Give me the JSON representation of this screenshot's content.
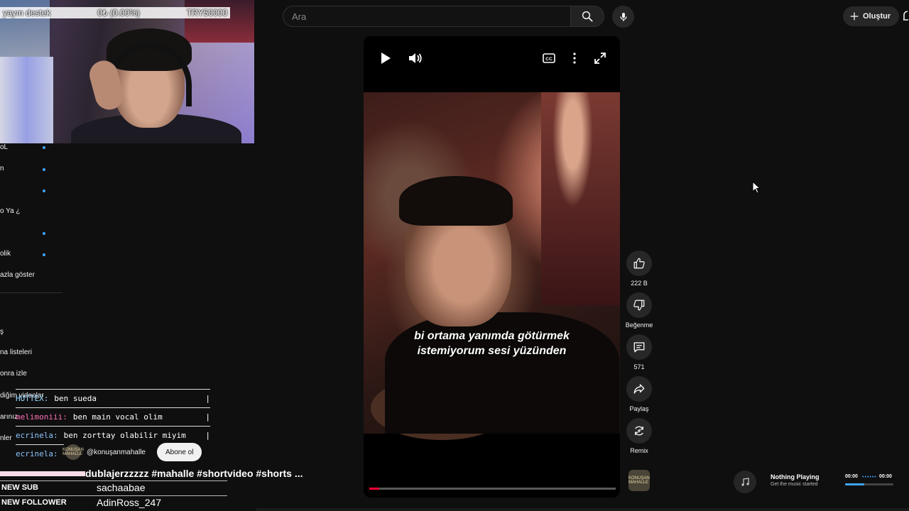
{
  "search": {
    "placeholder": "Ara"
  },
  "header": {
    "create_label": "Oluştur"
  },
  "stream_overlay": {
    "donation": {
      "label": "yayın destek",
      "progress": "0₺ (0.00%)",
      "goal": "TRY50000",
      "progress_fraction": 0
    },
    "alerts": [
      {
        "key": "NEW SUB",
        "value": "sachaabae"
      },
      {
        "key": "NEW FOLLOWER",
        "value": "AdinRoss_247"
      }
    ]
  },
  "sidebar": {
    "items": [
      "oL",
      "n",
      "o Ya ¿",
      "olik",
      "azla göster",
      "ş",
      "na listeleri",
      "onra izle",
      "diğim videolar",
      "arınız",
      "nler"
    ]
  },
  "chat": {
    "messages": [
      {
        "user": "HUTTEX:",
        "text": "ben sueda",
        "color": "#9ad7ff"
      },
      {
        "user": "melimoniii:",
        "text": "ben main vocal olim",
        "color": "#ff6fb5"
      },
      {
        "user": "ecrinela:",
        "text": "ben zorttay olabilir miyim",
        "color": "#8ec5ff"
      },
      {
        "user": "ecrinela:",
        "text": "",
        "color": "#8ec5ff"
      }
    ]
  },
  "short": {
    "channel_handle": "@konuşanmahalle",
    "channel_logo_text": "KONUŞAN MAHALLE",
    "subscribe_label": "Abone ol",
    "description": "dublajerzzzzz #mahalle #shortvideo #shorts ...",
    "caption_line1": "bi ortama yanımda götürmek",
    "caption_line2": "istemiyorum sesi yüzünden",
    "progress_fraction": 0.04
  },
  "actions": {
    "like_count": "222 B",
    "dislike_label": "Beğenme",
    "comment_count": "571",
    "share_label": "Paylaş",
    "remix_label": "Remix"
  },
  "now_playing": {
    "title": "Nothing Playing",
    "subtitle": "Get the music started",
    "time_elapsed": "00:00",
    "time_total": "00:00",
    "progress_fraction": 0.4
  },
  "colors": {
    "accent": "#3ea6ff",
    "progress_red": "#ff0033",
    "background": "#0f0f0f"
  }
}
